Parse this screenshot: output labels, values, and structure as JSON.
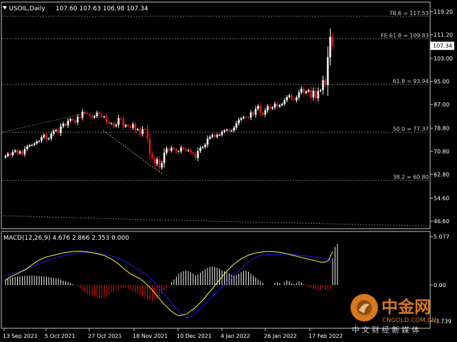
{
  "colors": {
    "background": "#000000",
    "frame": "#c8c8c8",
    "grid": "#8a8a8a",
    "bull_candle": "#ffffff",
    "bear_candle": "#e01818",
    "text": "#ffffff",
    "macd_line": "#ffff4d",
    "signal_line": "#1c1cf0",
    "hist_positive": "#ffffff",
    "hist_negative": "#e01818",
    "current_price_box": "#ffffff",
    "watermark": "#f0841e"
  },
  "header": {
    "symbol": "USOIL,Daily",
    "ohlc": "107.60 107.63 106.98 107.34",
    "indicator": "MACD(12,26,9) 4.676 2.866 2.353 0.000"
  },
  "price_axis": [
    "119.20",
    "111.20",
    "103.00",
    "95.00",
    "87.00",
    "78.80",
    "70.80",
    "62.80",
    "54.60",
    "46.60"
  ],
  "current_price": "107.34",
  "fib_levels": [
    {
      "label": "78.6 = 117.53",
      "price": 117.53
    },
    {
      "label": "FE 61.8 = 109.83",
      "price": 109.83
    },
    {
      "label": "61.8 = 93.94",
      "price": 93.94
    },
    {
      "label": "50.0 = 77.37",
      "price": 77.37
    },
    {
      "label": "38.2 = 60.80",
      "price": 60.8
    }
  ],
  "macd_axis": [
    "5.077",
    "0.00",
    "-3.739"
  ],
  "date_axis": [
    "13 Sep 2021",
    "5 Oct 2021",
    "27 Oct 2021",
    "18 Nov 2021",
    "10 Dec 2021",
    "4 Jan 2022",
    "26 Jan 2022",
    "17 Feb 2022"
  ],
  "watermark": {
    "brand": "中金网",
    "domain": "CNGOLD.COM.CN",
    "slogan": "中 文 财 经 新 媒 体"
  },
  "chart_data": {
    "type": "candlestick",
    "price_range": [
      44.0,
      122.5
    ],
    "macd_range": [
      -4.5,
      5.6
    ],
    "close": [
      69.2,
      70.0,
      69.5,
      70.6,
      71.1,
      70.1,
      70.8,
      69.8,
      71.6,
      72.5,
      72.9,
      73.0,
      73.5,
      74.2,
      74.4,
      75.7,
      76.5,
      75.0,
      75.3,
      76.8,
      77.9,
      78.2,
      77.2,
      79.4,
      80.4,
      79.8,
      81.4,
      82.0,
      81.5,
      80.8,
      82.7,
      82.5,
      84.5,
      84.0,
      83.8,
      83.2,
      82.5,
      83.0,
      84.2,
      83.6,
      82.7,
      82.8,
      81.1,
      80.4,
      80.5,
      79.5,
      80.0,
      82.3,
      82.0,
      79.4,
      79.9,
      79.5,
      79.0,
      80.2,
      78.2,
      78.5,
      76.8,
      78.5,
      78.4,
      75.2,
      70.0,
      68.5,
      66.5,
      68.0,
      65.2,
      66.7,
      70.3,
      71.7,
      71.0,
      72.0,
      71.5,
      70.7,
      70.8,
      72.1,
      71.5,
      71.0,
      71.2,
      70.4,
      70.0,
      68.5,
      70.9,
      72.0,
      72.3,
      73.1,
      75.2,
      75.8,
      76.5,
      75.8,
      76.5,
      76.5,
      77.5,
      78.0,
      78.3,
      77.8,
      78.0,
      79.0,
      80.5,
      81.7,
      82.3,
      82.7,
      82.6,
      82.5,
      84.3,
      83.5,
      85.5,
      86.5,
      84.2,
      83.5,
      85.0,
      86.4,
      85.6,
      86.0,
      87.3,
      86.3,
      86.8,
      87.2,
      88.5,
      89.6,
      90.2,
      89.0,
      88.5,
      89.5,
      91.2,
      92.5,
      91.0,
      91.5,
      92.0,
      89.5,
      91.8,
      89.2,
      91.7,
      92.0,
      95.5,
      93.8,
      103.4,
      110.5,
      107.34
    ],
    "macd_histogram": [
      0.6,
      0.67,
      0.73,
      0.8,
      0.85,
      0.9,
      0.93,
      0.95,
      0.97,
      0.98,
      1.0,
      1.0,
      0.99,
      0.97,
      0.95,
      0.93,
      0.9,
      0.86,
      0.83,
      0.8,
      0.75,
      0.7,
      0.64,
      0.56,
      0.47,
      0.38,
      0.29,
      0.2,
      0.11,
      0.03,
      -0.1,
      -0.3,
      -0.5,
      -0.7,
      -0.9,
      -1.05,
      -1.15,
      -1.25,
      -1.3,
      -1.35,
      -1.4,
      -1.3,
      -1.2,
      -1.0,
      -0.8,
      -0.6,
      -0.5,
      -0.4,
      -0.3,
      -0.25,
      -0.3,
      -0.4,
      -0.5,
      -0.6,
      -0.75,
      -0.9,
      -1.0,
      -1.2,
      -1.4,
      -1.5,
      -1.6,
      -1.7,
      -1.5,
      -1.4,
      -1.2,
      -0.9,
      -0.6,
      -0.3,
      0.0,
      0.3,
      0.6,
      0.9,
      1.2,
      1.35,
      1.45,
      1.5,
      1.45,
      1.35,
      1.2,
      1.0,
      1.1,
      1.3,
      1.5,
      1.65,
      1.8,
      1.9,
      1.95,
      1.9,
      1.8,
      1.7,
      1.55,
      1.45,
      1.35,
      1.2,
      1.1,
      1.0,
      1.05,
      1.2,
      1.35,
      1.45,
      1.5,
      1.4,
      1.2,
      1.0,
      0.8,
      0.6,
      0.4,
      0.2,
      0.0,
      0.0,
      0.0,
      0.0,
      0.2,
      0.3,
      0.2,
      0.0,
      0.3,
      0.5,
      0.4,
      0.2,
      0.1,
      0.2,
      0.4,
      0.3,
      0.1,
      -0.1,
      -0.2,
      -0.3,
      -0.4,
      -0.5,
      -0.6,
      -0.5,
      -0.3,
      -0.5,
      -0.6,
      -0.4,
      2.8,
      4.0,
      4.3
    ],
    "macd_line": [
      0.5,
      0.8,
      1.0,
      1.2,
      1.4,
      1.6,
      1.9,
      2.2,
      2.5,
      2.7,
      2.9,
      3.0,
      3.1,
      3.2,
      3.3,
      3.4,
      3.45,
      3.5,
      3.52,
      3.53,
      3.5,
      3.45,
      3.4,
      3.3,
      3.2,
      3.1,
      2.9,
      2.7,
      2.4,
      2.1,
      1.7,
      1.4,
      1.1,
      0.9,
      0.7,
      0.4,
      0.0,
      -0.4,
      -0.9,
      -1.4,
      -1.9,
      -2.3,
      -2.7,
      -3.0,
      -3.2,
      -3.1,
      -3.0,
      -2.7,
      -2.4,
      -2.0,
      -1.6,
      -1.1,
      -0.6,
      -0.1,
      0.4,
      0.9,
      1.4,
      1.8,
      2.2,
      2.5,
      2.8,
      3.0,
      3.2,
      3.3,
      3.4,
      3.45,
      3.5,
      3.5,
      3.48,
      3.45,
      3.4,
      3.3,
      3.2,
      3.1,
      3.0,
      2.9,
      2.8,
      2.7,
      2.6,
      2.5,
      2.4,
      2.4,
      2.6,
      3.5
    ],
    "signal_line": [
      1.0,
      1.1,
      1.2,
      1.35,
      1.5,
      1.65,
      1.8,
      1.95,
      2.1,
      2.3,
      2.45,
      2.6,
      2.75,
      2.9,
      3.0,
      3.1,
      3.2,
      3.25,
      3.3,
      3.35,
      3.4,
      3.4,
      3.4,
      3.35,
      3.3,
      3.25,
      3.15,
      3.05,
      2.9,
      2.75,
      2.55,
      2.3,
      2.05,
      1.8,
      1.55,
      1.3,
      1.0,
      0.6,
      0.2,
      -0.3,
      -0.8,
      -1.3,
      -1.8,
      -2.3,
      -2.7,
      -3.1,
      -3.4,
      -3.3,
      -3.0,
      -2.6,
      -2.2,
      -1.8,
      -1.4,
      -1.0,
      -0.6,
      -0.2,
      0.2,
      0.6,
      1.0,
      1.4,
      1.8,
      2.2,
      2.5,
      2.8,
      3.0,
      3.1,
      3.15,
      3.2,
      3.2,
      3.2,
      3.2,
      3.25,
      3.25,
      3.2,
      3.15,
      3.1,
      3.05,
      3.0,
      2.95,
      2.9,
      2.85,
      2.8,
      2.7,
      2.6
    ]
  }
}
